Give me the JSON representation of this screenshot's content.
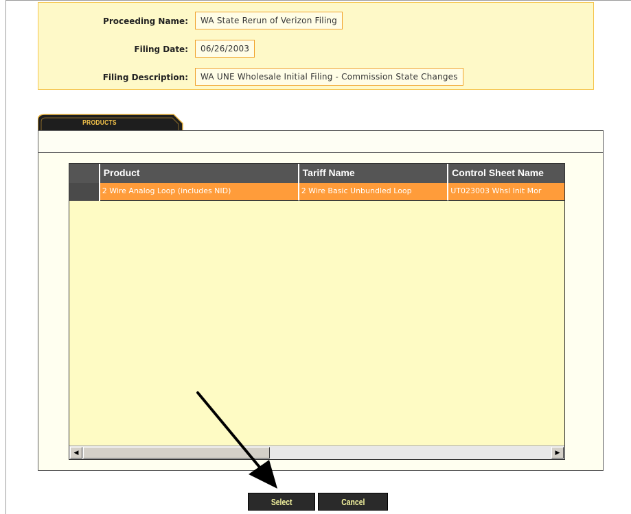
{
  "header": {
    "proceeding_name_label": "Proceeding Name:",
    "proceeding_name_value": "WA State Rerun of Verizon Filing",
    "filing_date_label": "Filing Date:",
    "filing_date_value": "06/26/2003",
    "filing_description_label": "Filing Description:",
    "filing_description_value": "WA UNE Wholesale Initial Filing - Commission State Changes"
  },
  "tab": {
    "label": "PRODUCTS"
  },
  "grid": {
    "columns": [
      "Product",
      "Tariff Name",
      "Control Sheet Name"
    ],
    "rows": [
      [
        "2 Wire Analog Loop (includes NID)",
        "2 Wire Basic Unbundled Loop",
        "UT023003 Whsl Init Mor"
      ]
    ]
  },
  "buttons": {
    "select": "Select",
    "cancel": "Cancel"
  },
  "colors": {
    "header_bg": "#fef9c8",
    "header_border": "#f5c44a",
    "selected_row": "#ff9c3a",
    "grid_header": "#555555",
    "button_bg": "#2a2a2a",
    "button_text": "#f6f6a0"
  }
}
